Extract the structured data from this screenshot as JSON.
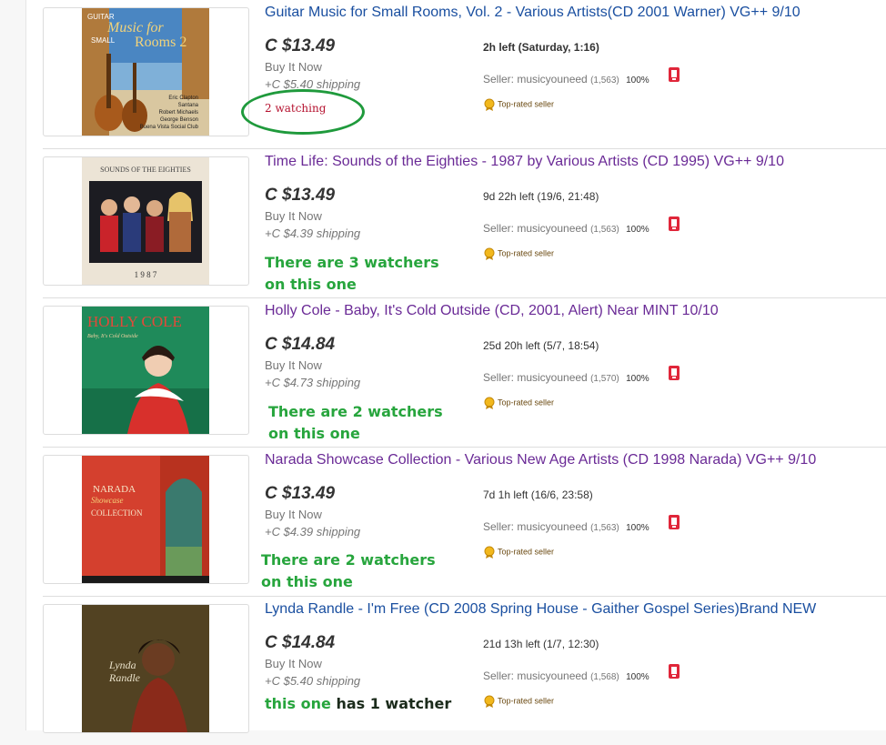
{
  "listings": [
    {
      "title": "Guitar Music for Small Rooms, Vol. 2 - Various Artists(CD 2001 Warner) VG++ 9/10",
      "price": "C $13.49",
      "format": "Buy It Now",
      "shipping": "+C $5.40 shipping",
      "time_left": "2h left (Saturday, 1:16)",
      "seller_prefix": "Seller: musicyouneed",
      "seller_feedback": "(1,563)",
      "seller_percent": "100%",
      "top_rated": "Top-rated seller",
      "watching": "2 watching",
      "cover": {
        "line1": "GUITAR",
        "line2": "Music for",
        "line3": "SMALL",
        "line4": "Rooms 2",
        "artists": [
          "Eric Clapton",
          "Santana",
          "Robert Michaels",
          "George Benson",
          "Buena Vista Social Club"
        ]
      }
    },
    {
      "title": "Time Life: Sounds of the Eighties - 1987 by Various Artists (CD 1995) VG++ 9/10",
      "price": "C $13.49",
      "format": "Buy It Now",
      "shipping": "+C $4.39 shipping",
      "time_left": "9d 22h left (19/6, 21:48)",
      "seller_prefix": "Seller: musicyouneed",
      "seller_feedback": "(1,563)",
      "seller_percent": "100%",
      "top_rated": "Top-rated seller",
      "annotation_line1": "There are 3 watchers",
      "annotation_line2": "on this one",
      "cover": {
        "top": "SOUNDS OF THE EIGHTIES",
        "year": "1 9 8 7"
      }
    },
    {
      "title": "Holly Cole - Baby, It's Cold Outside (CD, 2001, Alert) Near MINT 10/10",
      "price": "C $14.84",
      "format": "Buy It Now",
      "shipping": "+C $4.73 shipping",
      "time_left": "25d 20h left (5/7, 18:54)",
      "seller_prefix": "Seller: musicyouneed",
      "seller_feedback": "(1,570)",
      "seller_percent": "100%",
      "top_rated": "Top-rated seller",
      "annotation_line1": "There are 2 watchers",
      "annotation_line2": "on this one",
      "cover": {
        "name": "HOLLY COLE",
        "sub": "Baby, It's Cold Outside"
      }
    },
    {
      "title": "Narada Showcase Collection - Various New Age Artists (CD 1998 Narada) VG++ 9/10",
      "price": "C $13.49",
      "format": "Buy It Now",
      "shipping": "+C $4.39 shipping",
      "time_left": "7d 1h left (16/6, 23:58)",
      "seller_prefix": "Seller: musicyouneed",
      "seller_feedback": "(1,563)",
      "seller_percent": "100%",
      "top_rated": "Top-rated seller",
      "annotation_line1": "There are 2 watchers",
      "annotation_line2": "on this one",
      "cover": {
        "line1": "NARADA",
        "line2": "Showcase",
        "line3": "COLLECTION"
      }
    },
    {
      "title": "Lynda Randle - I'm Free (CD 2008 Spring House - Gaither Gospel Series)Brand NEW",
      "price": "C $14.84",
      "format": "Buy It Now",
      "shipping": "+C $5.40 shipping",
      "time_left": "21d 13h left (1/7, 12:30)",
      "seller_prefix": "Seller: musicyouneed",
      "seller_feedback": "(1,568)",
      "seller_percent": "100%",
      "top_rated": "Top-rated seller",
      "annotation_green": "this one",
      "annotation_dark": "has 1 watcher",
      "cover": {
        "line1": "Lynda",
        "line2": "Randle"
      }
    }
  ],
  "colors": {
    "title_unvisited": "#1a4fa0",
    "title_visited": "#6a2a96",
    "annotation_green": "#27a53d",
    "watch_red": "#b5122f",
    "circle_green": "#1f9a3c"
  },
  "icons": {
    "seller_badge": "red-phone-icon",
    "top_rated": "gold-medal-icon"
  }
}
